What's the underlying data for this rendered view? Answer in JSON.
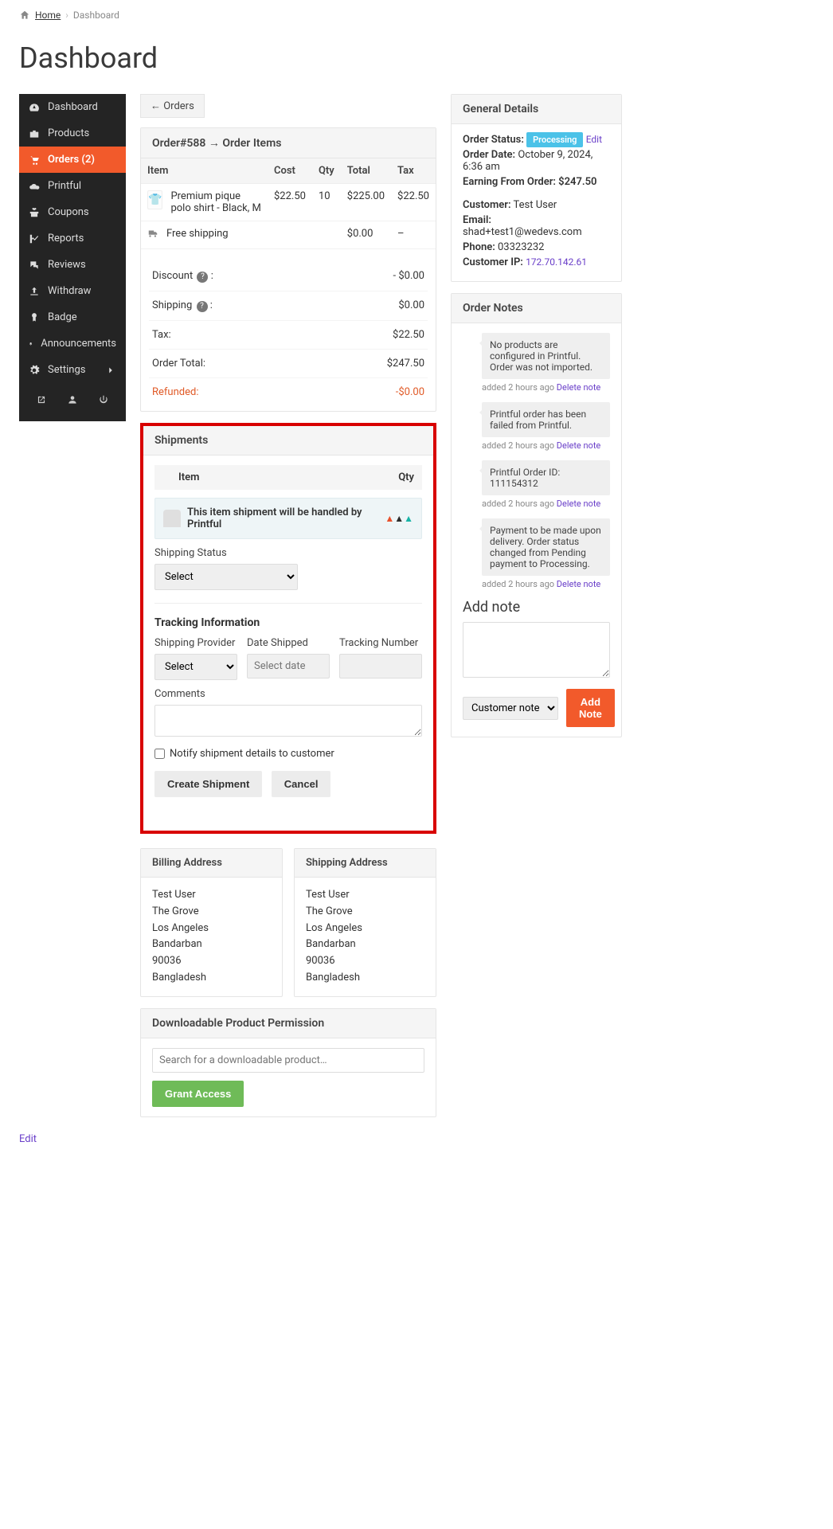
{
  "breadcrumbs": {
    "home": "Home",
    "current": "Dashboard"
  },
  "page_title": "Dashboard",
  "sidebar": {
    "items": [
      {
        "label": "Dashboard"
      },
      {
        "label": "Products"
      },
      {
        "label": "Orders (2)"
      },
      {
        "label": "Printful"
      },
      {
        "label": "Coupons"
      },
      {
        "label": "Reports"
      },
      {
        "label": "Reviews"
      },
      {
        "label": "Withdraw"
      },
      {
        "label": "Badge"
      },
      {
        "label": "Announcements"
      },
      {
        "label": "Settings"
      }
    ]
  },
  "backBtn": "← Orders",
  "orderHeader": "Order#588 → Order Items",
  "table": {
    "h_item": "Item",
    "h_cost": "Cost",
    "h_qty": "Qty",
    "h_total": "Total",
    "h_tax": "Tax",
    "item_name": "Premium pique polo shirt - Black, M",
    "item_cost": "$22.50",
    "item_qty": "10",
    "item_total": "$225.00",
    "item_tax": "$22.50",
    "ship_label": "Free shipping",
    "ship_cost": "$0.00",
    "ship_tax": "–"
  },
  "totals": {
    "discount_label": "Discount",
    "discount_val": "- $0.00",
    "shipping_label": "Shipping",
    "shipping_val": "$0.00",
    "tax_label": "Tax:",
    "tax_val": "$22.50",
    "ordertotal_label": "Order Total:",
    "ordertotal_val": "$247.50",
    "refunded_label": "Refunded:",
    "refunded_val": "-$0.00"
  },
  "shipments": {
    "heading": "Shipments",
    "th_item": "Item",
    "th_qty": "Qty",
    "banner": "This item shipment will be handled by Printful",
    "status_label": "Shipping Status",
    "status_placeholder": "Select",
    "tracking_heading": "Tracking Information",
    "provider_label": "Shipping Provider",
    "provider_placeholder": "Select",
    "date_label": "Date Shipped",
    "date_placeholder": "Select date",
    "tracknum_label": "Tracking Number",
    "comments_label": "Comments",
    "notify_label": "Notify shipment details to customer",
    "create_btn": "Create Shipment",
    "cancel_btn": "Cancel"
  },
  "billing": {
    "heading": "Billing Address",
    "lines": [
      "Test User",
      "The Grove",
      "Los Angeles",
      "Bandarban",
      "90036",
      "Bangladesh"
    ]
  },
  "shipping": {
    "heading": "Shipping Address",
    "lines": [
      "Test User",
      "The Grove",
      "Los Angeles",
      "Bandarban",
      "90036",
      "Bangladesh"
    ]
  },
  "download": {
    "heading": "Downloadable Product Permission",
    "placeholder": "Search for a downloadable product…",
    "grant": "Grant Access"
  },
  "general": {
    "heading": "General Details",
    "status_label": "Order Status:",
    "status_badge": "Processing",
    "edit": "Edit",
    "date_label": "Order Date:",
    "date_val": "October 9, 2024, 6:36 am",
    "earning_label": "Earning From Order:",
    "earning_val": "$247.50",
    "cust_label": "Customer:",
    "cust_val": "Test User",
    "email_label": "Email:",
    "email_val": "shad+test1@wedevs.com",
    "phone_label": "Phone:",
    "phone_val": "03323232",
    "ip_label": "Customer IP:",
    "ip_val": "172.70.142.61"
  },
  "notes": {
    "heading": "Order Notes",
    "meta_prefix": "added 2 hours ago",
    "delete": "Delete note",
    "items": [
      "No products are configured in Printful. Order was not imported.",
      "Printful order has been failed from Printful.",
      "Printful Order ID: 111154312",
      "Payment to be made upon delivery. Order status changed from Pending payment to Processing."
    ],
    "addnote_heading": "Add note",
    "note_type": "Customer note",
    "add_btn": "Add Note"
  },
  "footer_edit": "Edit"
}
